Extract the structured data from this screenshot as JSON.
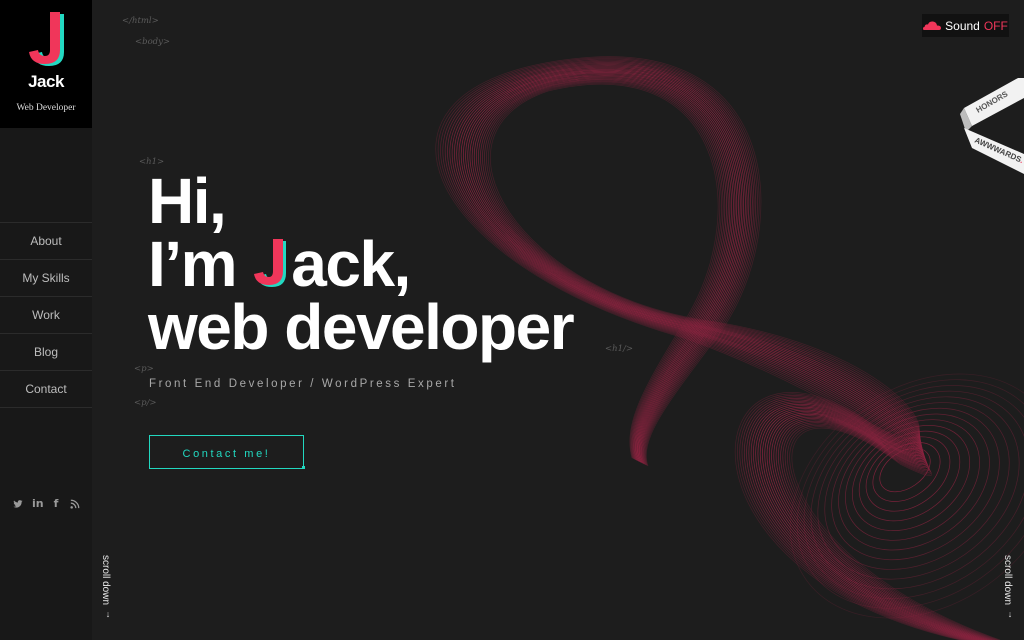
{
  "brand": {
    "initial": "J",
    "name": "Jack",
    "tagline": "Web Developer"
  },
  "nav": [
    {
      "label": "About"
    },
    {
      "label": "My Skills"
    },
    {
      "label": "Work"
    },
    {
      "label": "Blog"
    },
    {
      "label": "Contact"
    }
  ],
  "social": [
    "twitter-icon",
    "linkedin-icon",
    "facebook-icon",
    "rss-icon"
  ],
  "sound": {
    "label": "Sound",
    "state": "OFF"
  },
  "honors": {
    "top": "HONORS",
    "bottom": "AWWWARDS",
    "bottom_suffix": "."
  },
  "code_tags": {
    "html": "</html>",
    "body": "<body>",
    "h1_open": "<h1>",
    "h1_close": "<h1/>",
    "p_open": "<p>",
    "p_close": "<p/>"
  },
  "hero": {
    "line1": "Hi,",
    "line2_pre": "I’m ",
    "line2_post": "ack,",
    "line3": "web developer",
    "subtitle": "Front End Developer / WordPress Expert",
    "cta": "Contact me!"
  },
  "scroll_label": "scroll down",
  "colors": {
    "accent_pink": "#f0365a",
    "accent_teal": "#22d8c0",
    "background": "#1d1d1d"
  }
}
